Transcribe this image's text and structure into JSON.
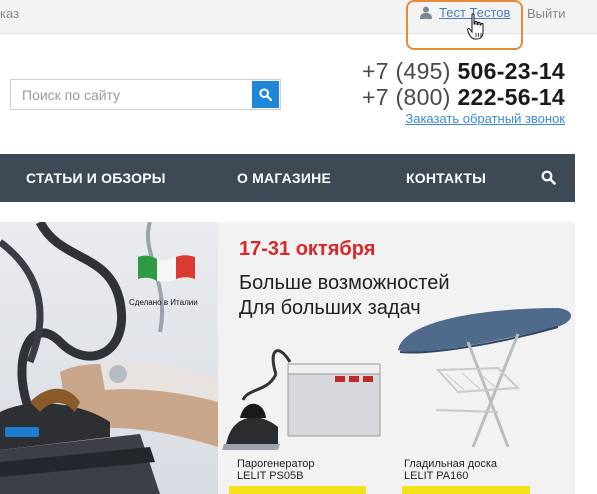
{
  "topbar": {
    "order_link": "каз",
    "user_name": "Тест Тестов",
    "logout": "Выйти"
  },
  "search": {
    "placeholder": "Поиск по сайту"
  },
  "contacts": {
    "phone1_prefix": "+7 (495) ",
    "phone1_number": "506-23-14",
    "phone2_prefix": "+7 (800) ",
    "phone2_number": "222-56-14",
    "callback": "Заказать обратный звонок"
  },
  "nav": {
    "items": [
      "СТАТЬИ И ОБЗОРЫ",
      "О МАГАЗИНЕ",
      "КОНТАКТЫ"
    ]
  },
  "banner": {
    "made_in": "Сделано в Италии",
    "dates": "17-31 октября",
    "headline_line1": "Больше возможностей",
    "headline_line2": "Для больших задач",
    "product1_line1": "Парогенератор",
    "product1_line2": "LELIT PS05B",
    "product2_line1": "Гладильная доска",
    "product2_line2": "LELIT PA160"
  },
  "colors": {
    "nav_bg": "#3d4955",
    "accent_blue": "#1f86d8",
    "promo_red": "#d8282b",
    "highlight": "#e98a3a"
  },
  "icons": [
    "user-icon",
    "search-icon",
    "hand-cursor-icon",
    "italy-flag"
  ]
}
